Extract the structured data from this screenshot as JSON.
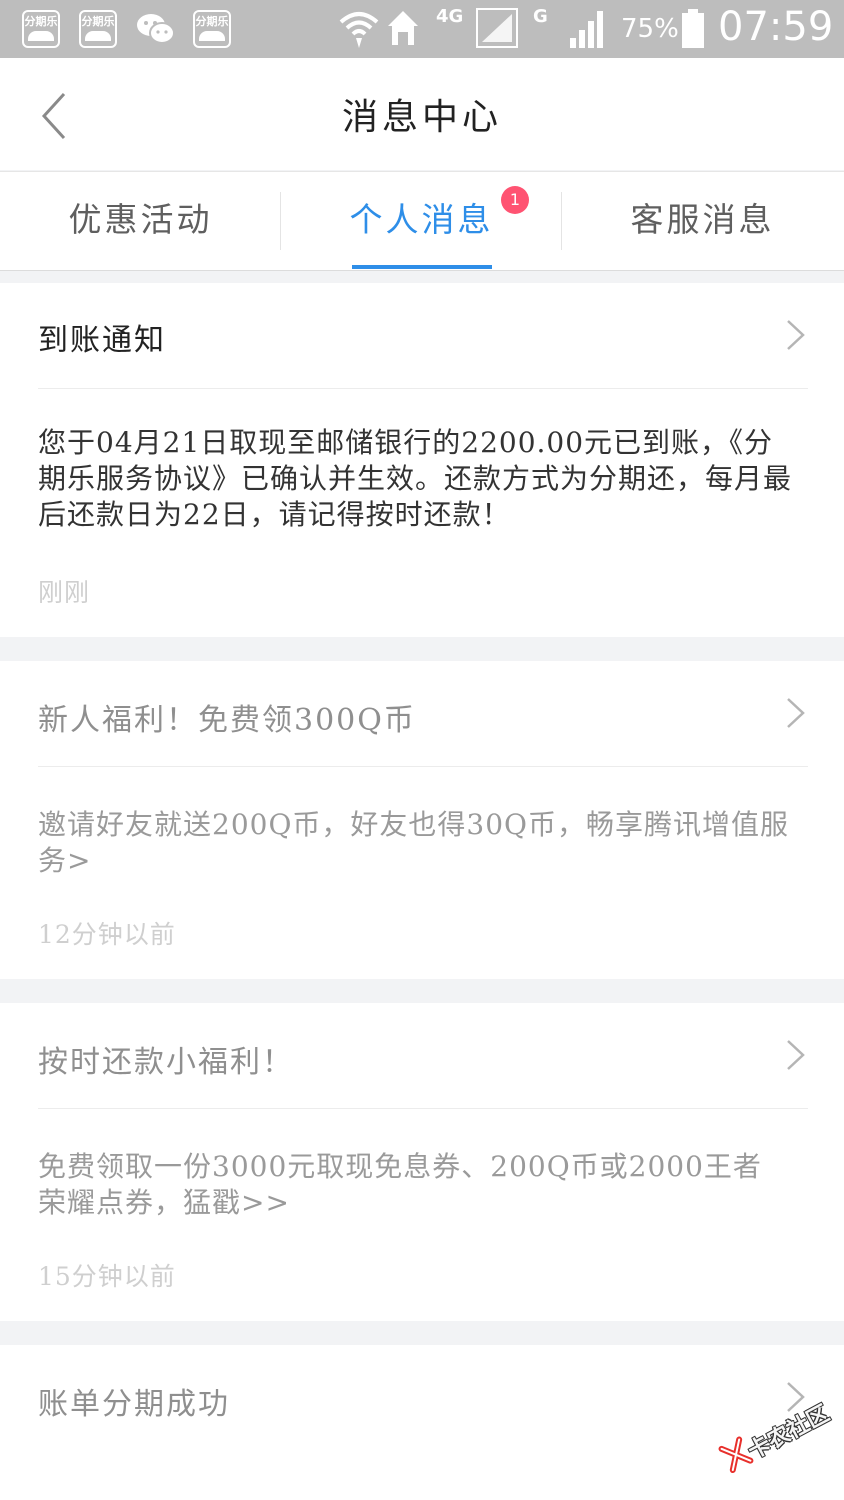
{
  "status_bar": {
    "apps": [
      {
        "label": "分期乐",
        "icon": "fenqile-app-icon"
      },
      {
        "label": "分期乐",
        "icon": "fenqile-app-icon"
      },
      {
        "label": "",
        "icon": "wechat-icon"
      },
      {
        "label": "分期乐",
        "icon": "fenqile-app-icon"
      }
    ],
    "network_4g": "4G",
    "network_g": "G",
    "battery": "75%",
    "time": "07:59"
  },
  "header": {
    "title": "消息中心"
  },
  "tabs": [
    {
      "label": "优惠活动",
      "active": false
    },
    {
      "label": "个人消息",
      "active": true,
      "badge": "1"
    },
    {
      "label": "客服消息",
      "active": false
    }
  ],
  "messages": [
    {
      "title": "到账通知",
      "body": "您于04月21日取现至邮储银行的2200.00元已到账，《分期乐服务协议》已确认并生效。还款方式为分期还，每月最后还款日为22日，请记得按时还款！",
      "time": "刚刚",
      "read": false
    },
    {
      "title": "新人福利！免费领300Q币",
      "body": "邀请好友就送200Q币，好友也得30Q币，畅享腾讯增值服务>",
      "time": "12分钟以前",
      "read": true
    },
    {
      "title": "按时还款小福利！",
      "body": "免费领取一份3000元取现免息券、200Q币或2000王者荣耀点券，猛戳>>",
      "time": "15分钟以前",
      "read": true
    },
    {
      "title": "账单分期成功",
      "body": "",
      "time": "",
      "read": true
    }
  ],
  "watermark": {
    "text": "卡农社区"
  },
  "colors": {
    "accent": "#2e8ee8",
    "badge": "#ff5372",
    "status_bar": "#bdbdbd",
    "page_bg": "#f2f3f5"
  }
}
